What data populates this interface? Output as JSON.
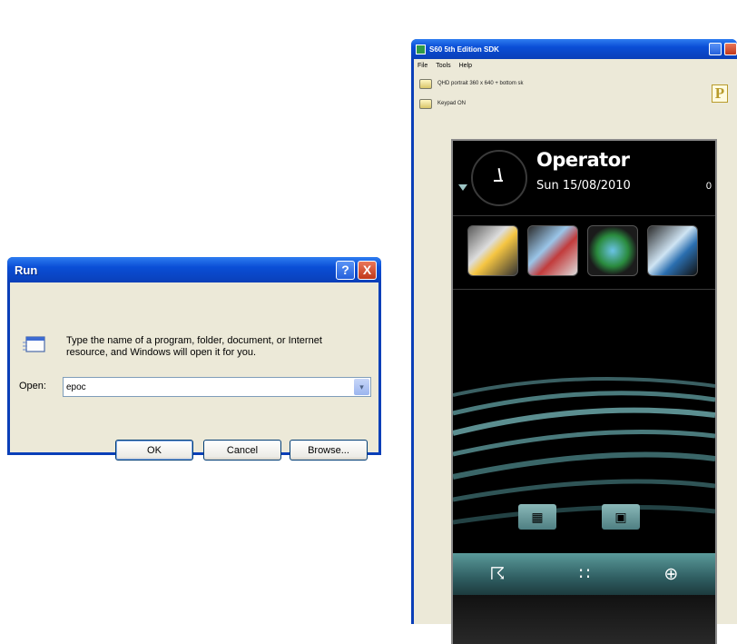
{
  "run_dialog": {
    "title": "Run",
    "help_icon": "?",
    "close_icon": "X",
    "description": "Type the name of a program, folder, document, or Internet resource, and Windows will open it for you.",
    "open_label": "Open:",
    "open_value": "epoc",
    "dropdown_icon": "▾",
    "buttons": {
      "ok": "OK",
      "cancel": "Cancel",
      "browse": "Browse..."
    }
  },
  "sdk_window": {
    "title": "S60 5th Edition SDK",
    "menu": [
      "File",
      "Tools",
      "Help"
    ],
    "layout_label": "QHD portrait 360 x 640 + bottom sk",
    "keypad_label": "Keypad ON",
    "logo_letter": "P",
    "phone": {
      "operator": "Operator",
      "date": "Sun 15/08/2010",
      "right_value": "0",
      "shortcut_icons": [
        "sparkle-icon",
        "messaging-icon",
        "globe-icon",
        "photos-icon"
      ],
      "softkey_icons": [
        "menu-grid-icon",
        "contacts-icon"
      ],
      "toolbar_icons": [
        "connectivity-icon",
        "dialpad-icon",
        "navigation-icon"
      ],
      "toolbar_glyphs": [
        "☈",
        "∷",
        "⊕"
      ],
      "softkey_glyphs": [
        "▦",
        "▣"
      ]
    }
  },
  "colors": {
    "xp_blue": "#0a3fb8",
    "xp_face": "#ece9d8",
    "phone_teal": "#4e7f82"
  }
}
